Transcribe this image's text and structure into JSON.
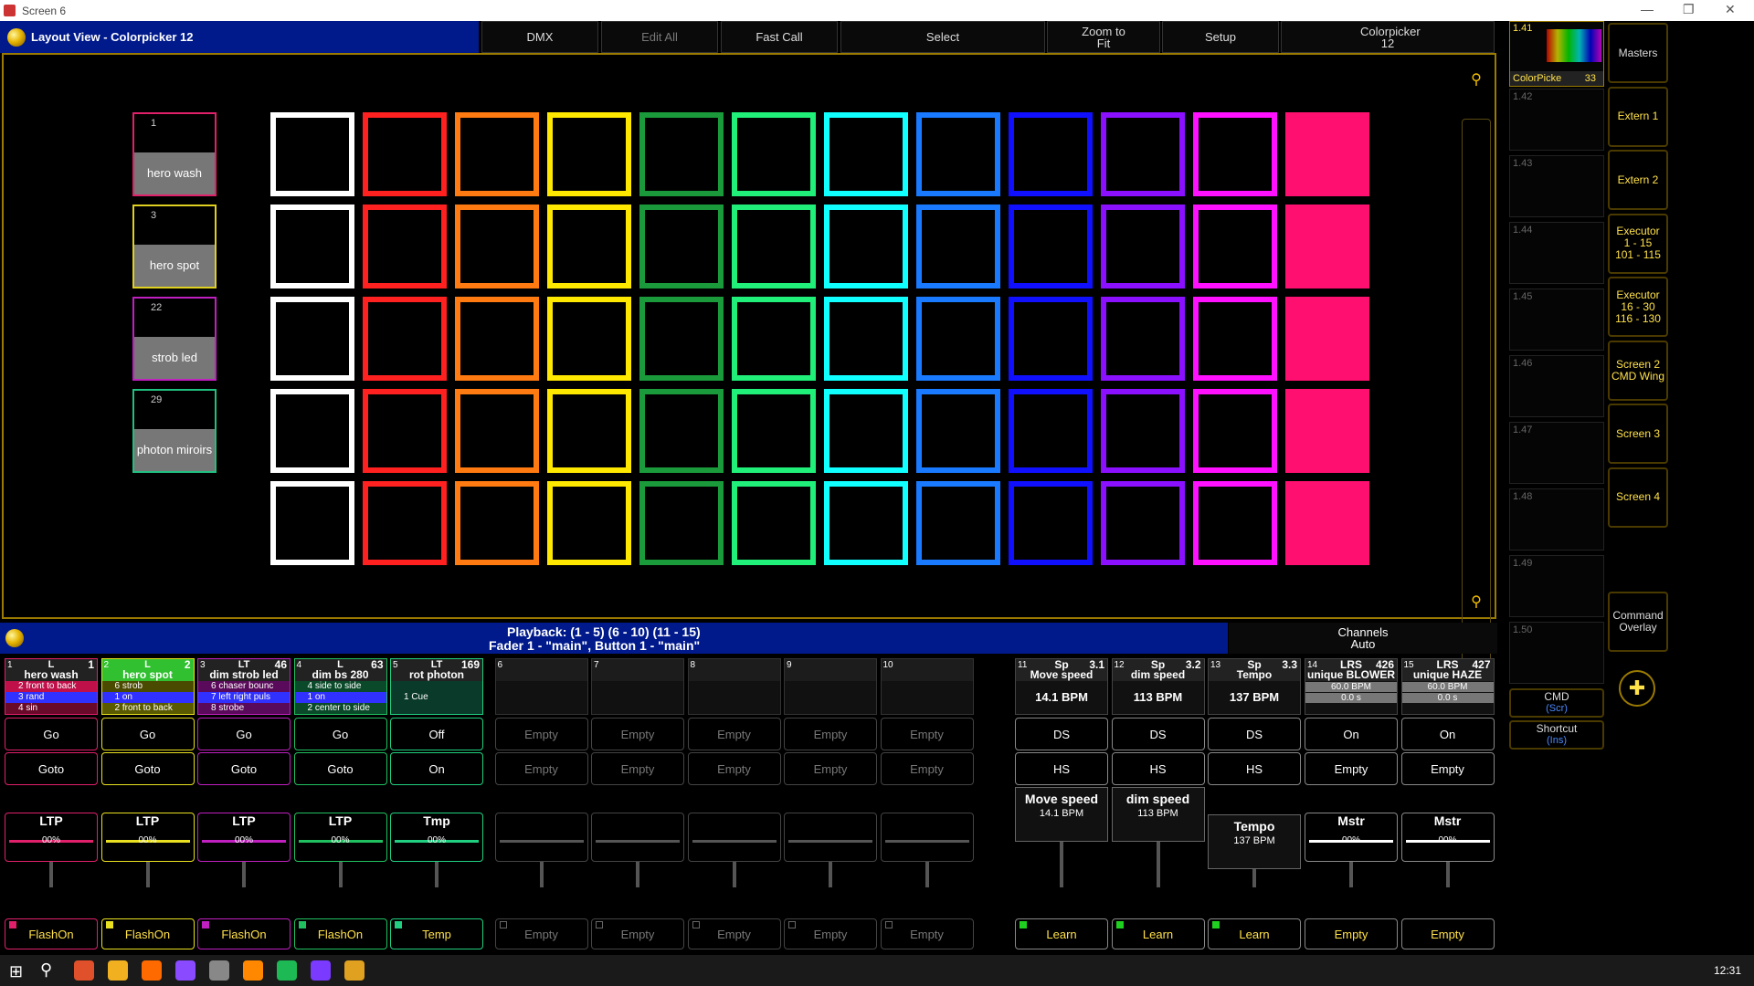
{
  "window": {
    "title": "Screen 6",
    "controls": [
      "—",
      "❐",
      "✕"
    ]
  },
  "layout_bar": {
    "title": "Layout View - Colorpicker 12"
  },
  "toolbar": [
    {
      "label": "DMX",
      "enabled": true
    },
    {
      "label": "Edit All",
      "enabled": false
    },
    {
      "label": "Fast Call",
      "enabled": true
    },
    {
      "label": "Select",
      "enabled": true
    },
    {
      "label": "Zoom to Fit",
      "enabled": true
    },
    {
      "label": "Setup",
      "enabled": true
    },
    {
      "label": "Colorpicker 12",
      "enabled": true
    }
  ],
  "fixtures": [
    {
      "number": "1",
      "label": "hero wash",
      "color": "#e0206a"
    },
    {
      "number": "3",
      "label": "hero spot",
      "color": "#e0d020"
    },
    {
      "number": "22",
      "label": "strob led",
      "color": "#c020c0"
    },
    {
      "number": "29",
      "label": "photon miroirs",
      "color": "#20c080"
    }
  ],
  "color_grid": {
    "rows": 5,
    "columns": [
      "#ffffff",
      "#ff2020",
      "#ff7a10",
      "#ffe800",
      "#1a9a3a",
      "#20f07a",
      "#10ffff",
      "#1a7aff",
      "#1010ff",
      "#8a10ff",
      "#ff10ff",
      "#ff1070"
    ],
    "filled_column": 11
  },
  "playback_bar": {
    "line1": "Playback: (1 - 5) (6 - 10) (11 - 15)",
    "line2": "Fader  1  - \"main\", Button  1  - \"main\"",
    "channels": "Channels",
    "auto": "Auto"
  },
  "executors": [
    {
      "num": "1",
      "mode": "L",
      "right": "1",
      "name": "hero wash",
      "color": "#e0206a",
      "lines": [
        {
          "text": "2 front to back",
          "bg": "#c0104a"
        },
        {
          "text": "3 rand",
          "bg": "#3030ff"
        },
        {
          "text": "4 sin",
          "bg": "#6a0a2a"
        }
      ],
      "btn1": "Go",
      "btn2": "Goto",
      "fader": "LTP",
      "fader_value": "00%",
      "bottom": "FlashOn",
      "fill": 0
    },
    {
      "num": "2",
      "mode": "L",
      "right": "2",
      "name": "hero spot",
      "color": "#e8e020",
      "lines": [
        {
          "text": "6 strob",
          "bg": "#4a4a00"
        },
        {
          "text": "1 on",
          "bg": "#3030ff"
        },
        {
          "text": "2 front to back",
          "bg": "#5a5a00"
        }
      ],
      "btn1": "Go",
      "btn2": "Goto",
      "fader": "LTP",
      "fader_value": "00%",
      "bottom": "FlashOn",
      "fill": 0
    },
    {
      "num": "3",
      "mode": "LT",
      "right": "46",
      "name": "dim strob led",
      "color": "#c020c0",
      "lines": [
        {
          "text": "6 chaser bounc",
          "bg": "#5a0a5a"
        },
        {
          "text": "7 left right puls",
          "bg": "#3030ff"
        },
        {
          "text": "8 strobe",
          "bg": "#5a0a5a"
        }
      ],
      "btn1": "Go",
      "btn2": "Goto",
      "fader": "LTP",
      "fader_value": "00%",
      "bottom": "FlashOn",
      "fill": 0
    },
    {
      "num": "4",
      "mode": "L",
      "right": "63",
      "name": "dim bs 280",
      "color": "#20c060",
      "lines": [
        {
          "text": "4 side to side",
          "bg": "#0a4a2a"
        },
        {
          "text": "1 on",
          "bg": "#3030ff"
        },
        {
          "text": "2 center to side",
          "bg": "#0a4a2a"
        }
      ],
      "btn1": "Go",
      "btn2": "Goto",
      "fader": "LTP",
      "fader_value": "00%",
      "bottom": "FlashOn",
      "fill": 0
    },
    {
      "num": "5",
      "mode": "LT",
      "right": "169",
      "name": "rot photon",
      "color": "#20d080",
      "lines": [
        {
          "text": "1 Cue",
          "bg": "#0a3a2a"
        }
      ],
      "btn1": "Off",
      "btn2": "On",
      "fader": "Tmp",
      "fader_value": "00%",
      "bottom": "Temp",
      "fill": 0
    },
    {
      "num": "6",
      "empty": true,
      "btn1": "Empty",
      "btn2": "Empty",
      "bottom": "Empty"
    },
    {
      "num": "7",
      "empty": true,
      "btn1": "Empty",
      "btn2": "Empty",
      "bottom": "Empty"
    },
    {
      "num": "8",
      "empty": true,
      "btn1": "Empty",
      "btn2": "Empty",
      "bottom": "Empty"
    },
    {
      "num": "9",
      "empty": true,
      "btn1": "Empty",
      "btn2": "Empty",
      "bottom": "Empty"
    },
    {
      "num": "10",
      "empty": true,
      "btn1": "Empty",
      "btn2": "Empty",
      "bottom": "Empty"
    }
  ],
  "speed_execs": [
    {
      "num": "11",
      "mode": "Sp",
      "right": "3.1",
      "name": "Move speed",
      "value": "14.1 BPM",
      "btn1": "DS",
      "btn2": "HS",
      "wlabel": "Move speed",
      "wvalue": "14.1  BPM",
      "bottom": "Learn"
    },
    {
      "num": "12",
      "mode": "Sp",
      "right": "3.2",
      "name": "dim speed",
      "value": "113 BPM",
      "btn1": "DS",
      "btn2": "HS",
      "wlabel": "dim speed",
      "wvalue": "113  BPM",
      "bottom": "Learn"
    },
    {
      "num": "13",
      "mode": "Sp",
      "right": "3.3",
      "name": "Tempo",
      "value": "137 BPM",
      "btn1": "DS",
      "btn2": "HS",
      "wlabel": "Tempo",
      "wvalue": "137  BPM",
      "bottom": "Learn"
    }
  ],
  "master_execs": [
    {
      "num": "14",
      "mode": "LRS",
      "right": "426",
      "name": "unique BLOWER",
      "l1": "60.0 BPM",
      "l2": "0.0 s",
      "btn1": "On",
      "btn2": "Empty",
      "fader": "Mstr",
      "fader_value": "00%",
      "bottom": "Empty"
    },
    {
      "num": "15",
      "mode": "LRS",
      "right": "427",
      "name": "unique HAZE",
      "l1": "60.0 BPM",
      "l2": "0.0 s",
      "btn1": "On",
      "btn2": "Empty",
      "fader": "Mstr",
      "fader_value": "00%",
      "bottom": "Empty"
    }
  ],
  "view_slots": {
    "active": {
      "id": "1.41",
      "name": "ColorPicke",
      "num": "33"
    },
    "slots": [
      "1.42",
      "1.43",
      "1.44",
      "1.45",
      "1.46",
      "1.47",
      "1.48",
      "1.49",
      "1.50"
    ]
  },
  "right_buttons": [
    "Masters",
    "Extern 1",
    "Extern 2",
    "Executor\n1 - 15\n101 - 115",
    "Executor\n16 - 30\n116 - 130",
    "Screen 2\nCMD Wing",
    "Screen 3",
    "Screen 4"
  ],
  "command_overlay": "Command\nOverlay",
  "cmd": {
    "label": "CMD",
    "sub": "(Scr)"
  },
  "shortcut": {
    "label": "Shortcut",
    "sub": "(Ins)"
  },
  "clock": "12:31"
}
